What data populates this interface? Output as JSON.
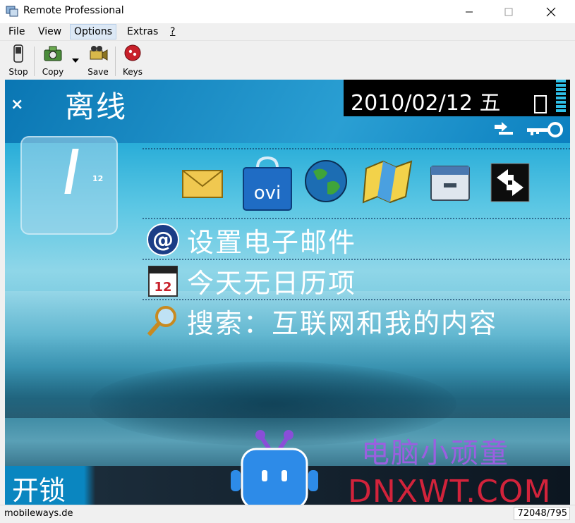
{
  "window": {
    "title": "Remote Professional",
    "minimize_icon": "minimize-icon",
    "maximize_icon": "maximize-icon",
    "close_icon": "close-icon"
  },
  "menu": [
    "File",
    "View",
    "Options",
    "Extras",
    "?"
  ],
  "menu_selected": "Options",
  "toolbar": {
    "stop_label": "Stop",
    "copy_label": "Copy",
    "save_label": "Save",
    "keys_label": "Keys"
  },
  "phone": {
    "close_glyph": "×",
    "status_text": "离线",
    "date_text": "2010/02/12 五",
    "clock_small": "12",
    "apps": [
      "envelope-icon",
      "ovi-store-icon",
      "globe-icon",
      "maps-icon",
      "file-manager-icon",
      "transfer-icon"
    ],
    "ovi_text": "ovi",
    "calendar_day": "12",
    "items": [
      {
        "icon": "at-sign-icon",
        "text": "设置电子邮件"
      },
      {
        "icon": "calendar-icon",
        "text": "今天无日历项"
      },
      {
        "icon": "search-icon",
        "text": "搜索：互联网和我的内容"
      }
    ],
    "softkey_left": "开锁"
  },
  "watermark": {
    "cn": "电脑小顽童",
    "en": "DNXWT.COM"
  },
  "statusbar": {
    "left": "mobileways.de",
    "right": "72048/795"
  },
  "colors": {
    "screen_blue": "#1fa8d6",
    "watermark_purple": "#9b5fe0",
    "watermark_red": "#d2233b"
  }
}
